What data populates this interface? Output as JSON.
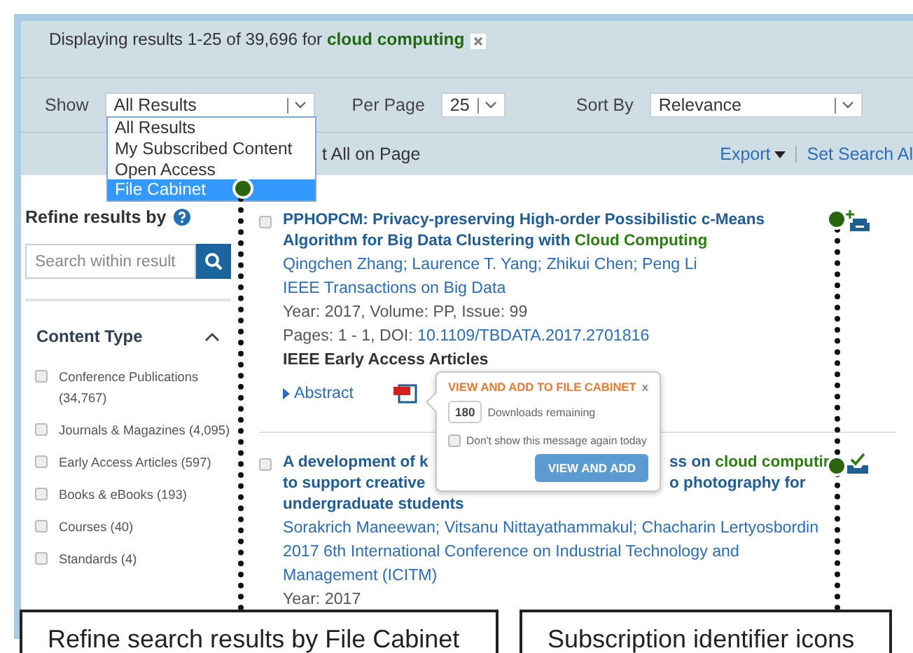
{
  "summary": {
    "prefix": "Displaying results 1-25 of 39,696 for",
    "query": "cloud computing"
  },
  "filters": [
    {
      "label": "Show",
      "value": "All Results",
      "kind": "show"
    },
    {
      "label": "Per Page",
      "value": "25",
      "kind": "perpage"
    },
    {
      "label": "Sort By",
      "value": "Relevance",
      "kind": "sort"
    }
  ],
  "show_dropdown": {
    "options": [
      {
        "label": "All Results",
        "selected": false
      },
      {
        "label": "My Subscribed Content",
        "selected": false
      },
      {
        "label": "Open Access",
        "selected": false
      },
      {
        "label": "File Cabinet",
        "selected": true
      }
    ]
  },
  "actions": {
    "select_all": "t All on Page",
    "export": "Export",
    "set_alert": "Set Search Al"
  },
  "sidebar": {
    "title": "Refine results by",
    "search": {
      "placeholder": "Search within result"
    },
    "content_type": {
      "title": "Content Type",
      "expanded": true,
      "items": [
        {
          "label": "Conference Publications (34,767)",
          "checked": false
        },
        {
          "label": "Journals & Magazines (4,095)",
          "checked": false
        },
        {
          "label": "Early Access Articles (597)",
          "checked": false
        },
        {
          "label": "Books & eBooks (193)",
          "checked": false
        },
        {
          "label": "Courses (40)",
          "checked": false
        },
        {
          "label": "Standards (4)",
          "checked": false
        }
      ]
    }
  },
  "results": [
    {
      "checked": false,
      "kind": "add",
      "title_lines": [
        {
          "left": [
            {
              "text": "PPHOPCM: Privacy-preserving High-order Possibilistic c-Means",
              "highlight": false
            }
          ]
        },
        {
          "left": [
            {
              "text": "Algorithm for Big Data Clustering with ",
              "highlight": false
            },
            {
              "text": "Cloud Computing",
              "highlight": true
            }
          ]
        }
      ],
      "authors": "Qingchen Zhang; Laurence T. Yang; Zhikui Chen; Peng Li",
      "publication": "IEEE Transactions on Big Data",
      "year": "Year: 2017, Volume: PP, Issue: 99",
      "pages": "Pages: 1 - 1, DOI:",
      "doi": "10.1109/TBDATA.2017.2701816",
      "type": "IEEE Early Access Articles",
      "abstract": "Abstract"
    },
    {
      "checked": false,
      "kind": "subscribed",
      "title_lines": [
        {
          "left": [
            {
              "text": "A development of k",
              "highlight": false
            }
          ],
          "right": [
            {
              "text": "ss on ",
              "highlight": false
            },
            {
              "text": "cloud computir",
              "highlight": true
            }
          ]
        },
        {
          "left": [
            {
              "text": "to support creative",
              "highlight": false
            }
          ],
          "right": [
            {
              "text": "o photography for",
              "highlight": false
            }
          ]
        },
        {
          "left": [
            {
              "text": "undergraduate students",
              "highlight": false
            }
          ]
        }
      ],
      "authors": "Sorakrich Maneewan; Vitsanu Nittayathammakul; Chacharin Lertyosbordin",
      "publication": "2017 6th International Conference on Industrial Technology and Management (ICITM)",
      "year": "Year: 2017"
    }
  ],
  "popup": {
    "title": "VIEW AND ADD TO FILE CABINET",
    "close": "x",
    "count": "180",
    "count_label": "Downloads remaining",
    "dont_show": {
      "label": "Don't show this message again today",
      "checked": false
    },
    "button": "VIEW AND ADD"
  },
  "callouts": [
    "Refine search results by File Cabinet",
    "Subscription identifier icons"
  ]
}
